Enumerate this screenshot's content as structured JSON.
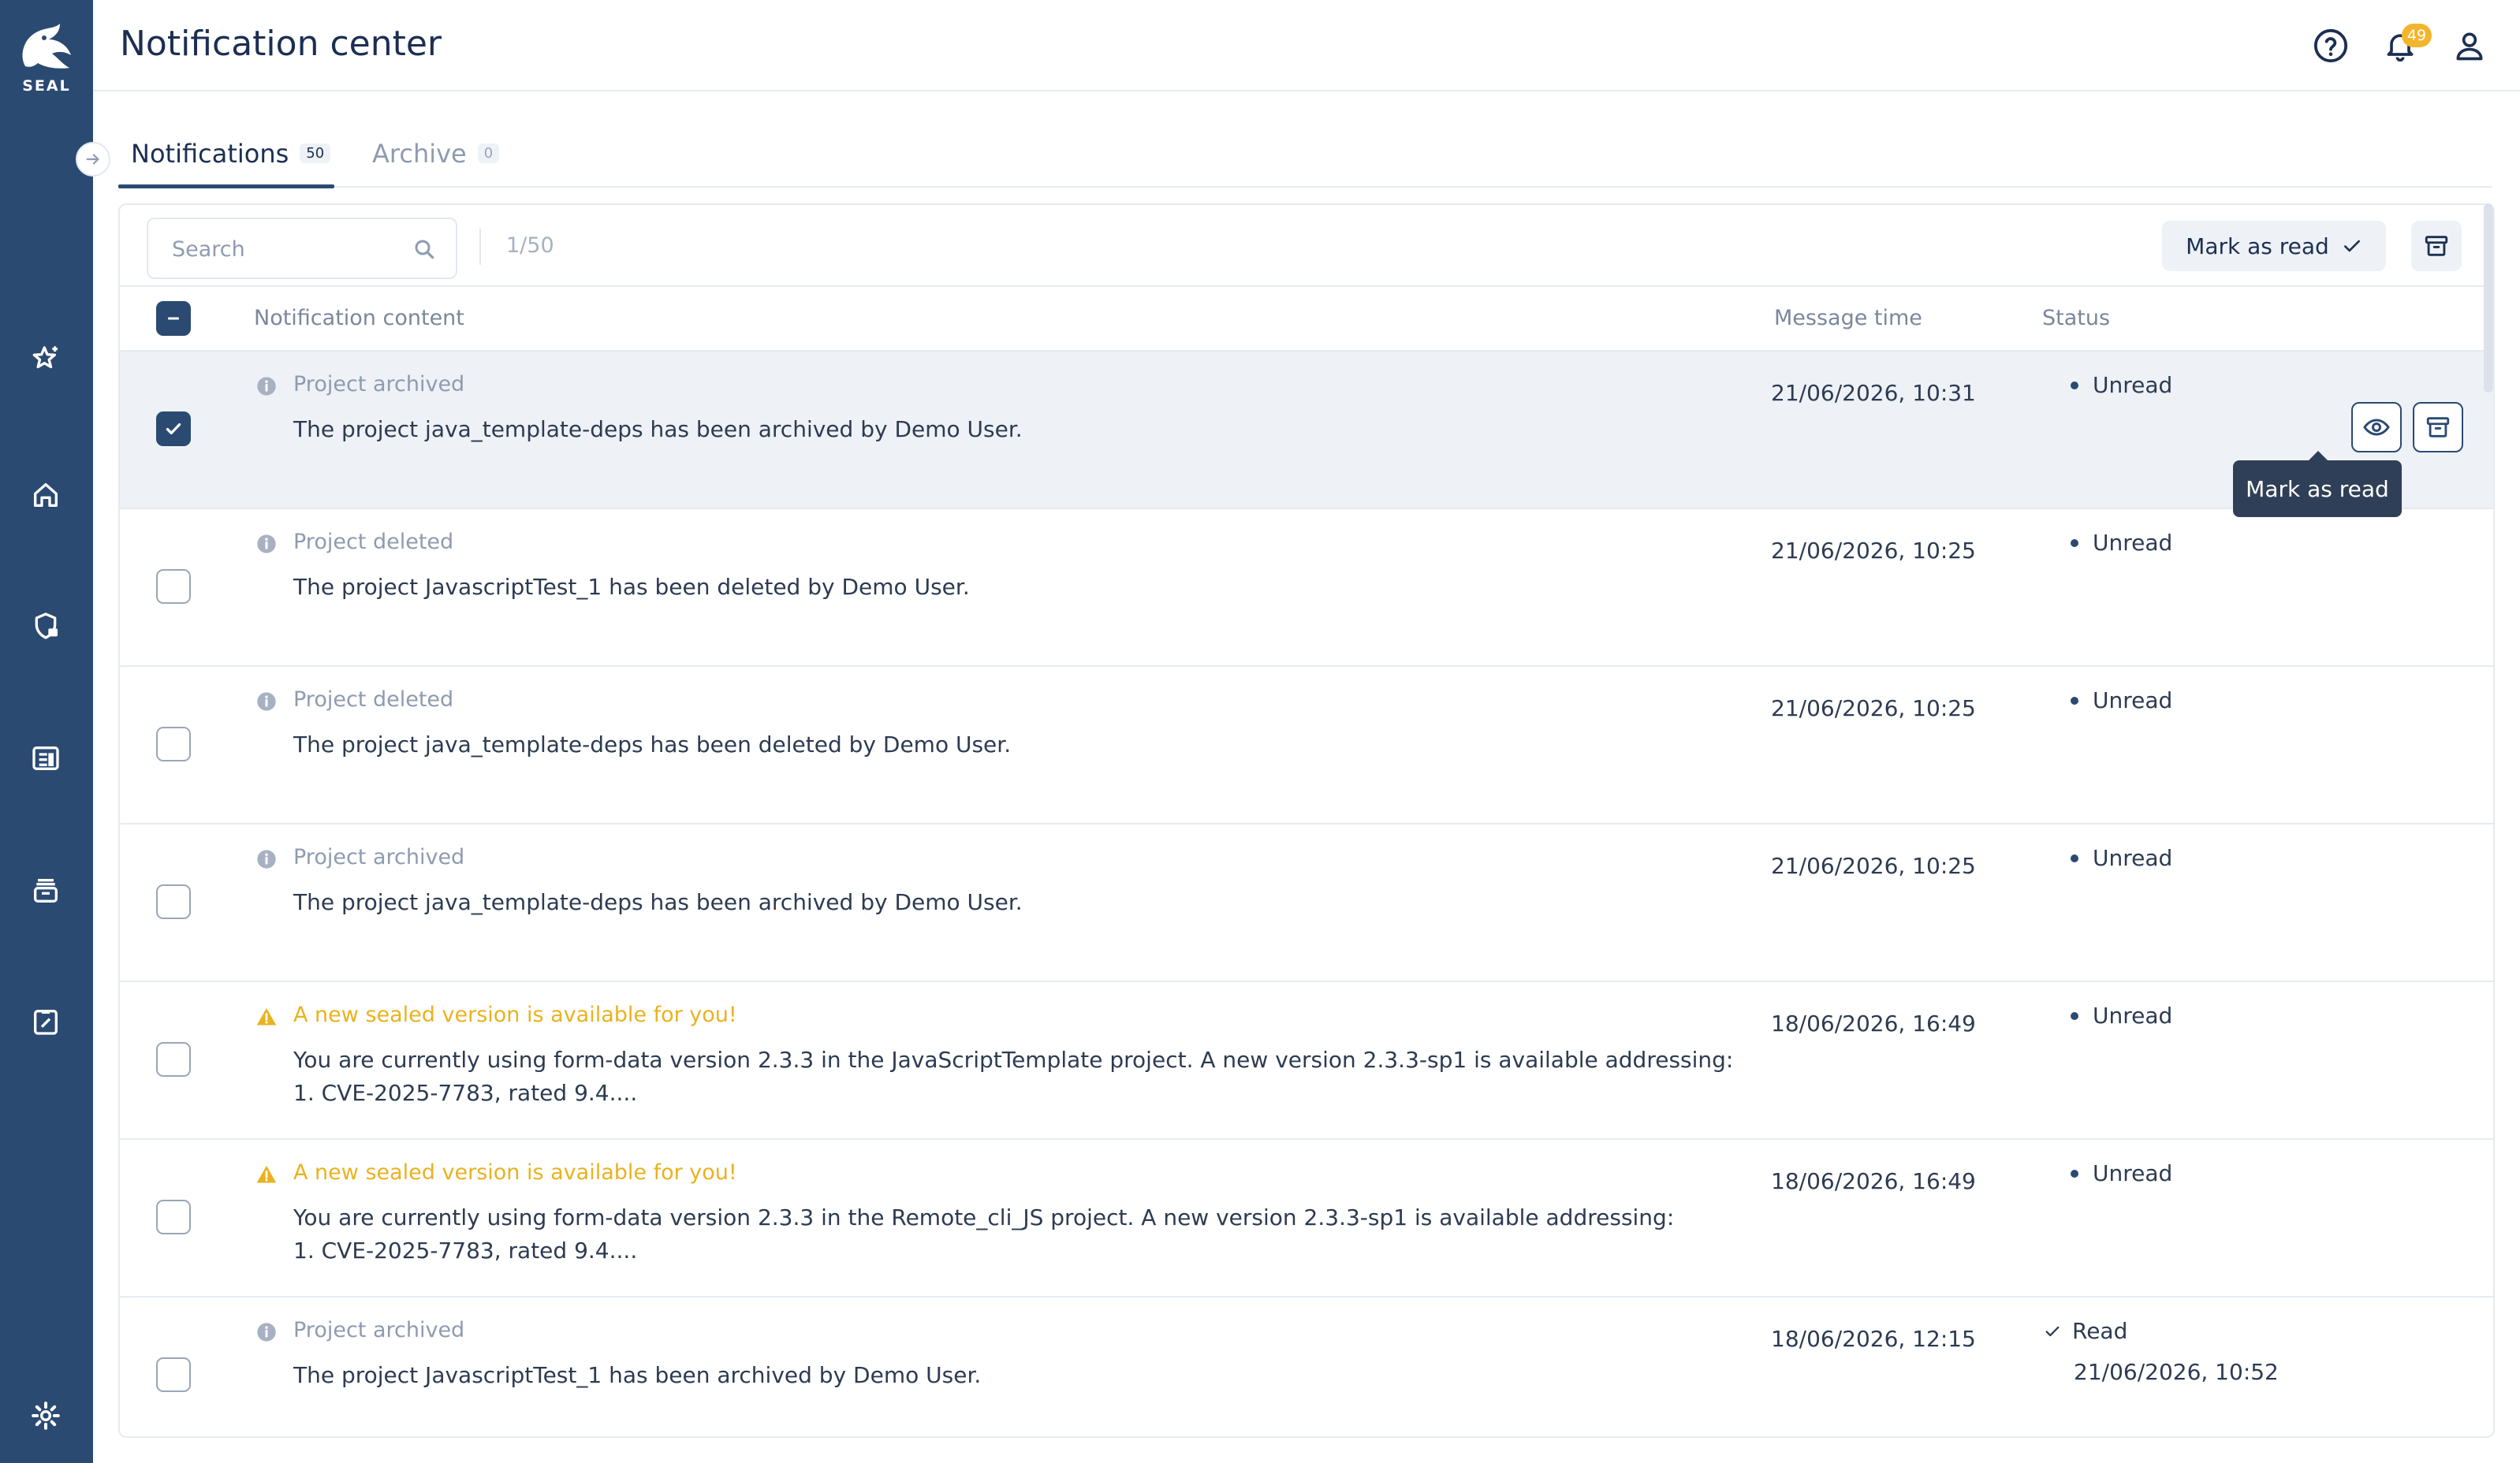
{
  "app": {
    "logo_text": "SEAL"
  },
  "header": {
    "title": "Notification center",
    "notification_count": "49"
  },
  "tabs": [
    {
      "label": "Notifications",
      "count": "50"
    },
    {
      "label": "Archive",
      "count": "0"
    }
  ],
  "toolbar": {
    "search_placeholder": "Search",
    "selection_count": "1/50",
    "mark_as_read_label": "Mark as read"
  },
  "table": {
    "columns": [
      "Notification content",
      "Message time",
      "Status"
    ],
    "rows": [
      {
        "title": "Project archived",
        "type": "info",
        "body": "The project java_template-deps has been archived by Demo User.",
        "time": "21/06/2026, 10:31",
        "status": "Unread",
        "selected": true
      },
      {
        "title": "Project deleted",
        "type": "info",
        "body": "The project JavascriptTest_1 has been deleted by Demo User.",
        "time": "21/06/2026, 10:25",
        "status": "Unread",
        "selected": false
      },
      {
        "title": "Project deleted",
        "type": "info",
        "body": "The project java_template-deps has been deleted by Demo User.",
        "time": "21/06/2026, 10:25",
        "status": "Unread",
        "selected": false
      },
      {
        "title": "Project archived",
        "type": "info",
        "body": "The project java_template-deps has been archived by Demo User.",
        "time": "21/06/2026, 10:25",
        "status": "Unread",
        "selected": false
      },
      {
        "title": "A new sealed version is available for you!",
        "type": "warning",
        "body_line1": "You are currently using form-data version 2.3.3 in the JavaScriptTemplate project. A new version 2.3.3-sp1 is available addressing:",
        "body_line2": "1. CVE-2025-7783, rated 9.4....",
        "time": "18/06/2026, 16:49",
        "status": "Unread",
        "selected": false
      },
      {
        "title": "A new sealed version is available for you!",
        "type": "warning",
        "body_line1": "You are currently using form-data version 2.3.3 in the Remote_cli_JS project. A new version 2.3.3-sp1 is available addressing:",
        "body_line2": "1. CVE-2025-7783, rated 9.4....",
        "time": "18/06/2026, 16:49",
        "status": "Unread",
        "selected": false
      },
      {
        "title": "Project archived",
        "type": "info",
        "body": "The project JavascriptTest_1 has been archived by Demo User.",
        "time": "18/06/2026, 12:15",
        "status": "Read",
        "read_time": "21/06/2026, 10:52",
        "selected": false
      }
    ]
  },
  "tooltip": {
    "text": "Mark as read"
  },
  "colors": {
    "sidebar": "#2b4a72",
    "warning": "#eab21f",
    "badge": "#f3b52d"
  }
}
